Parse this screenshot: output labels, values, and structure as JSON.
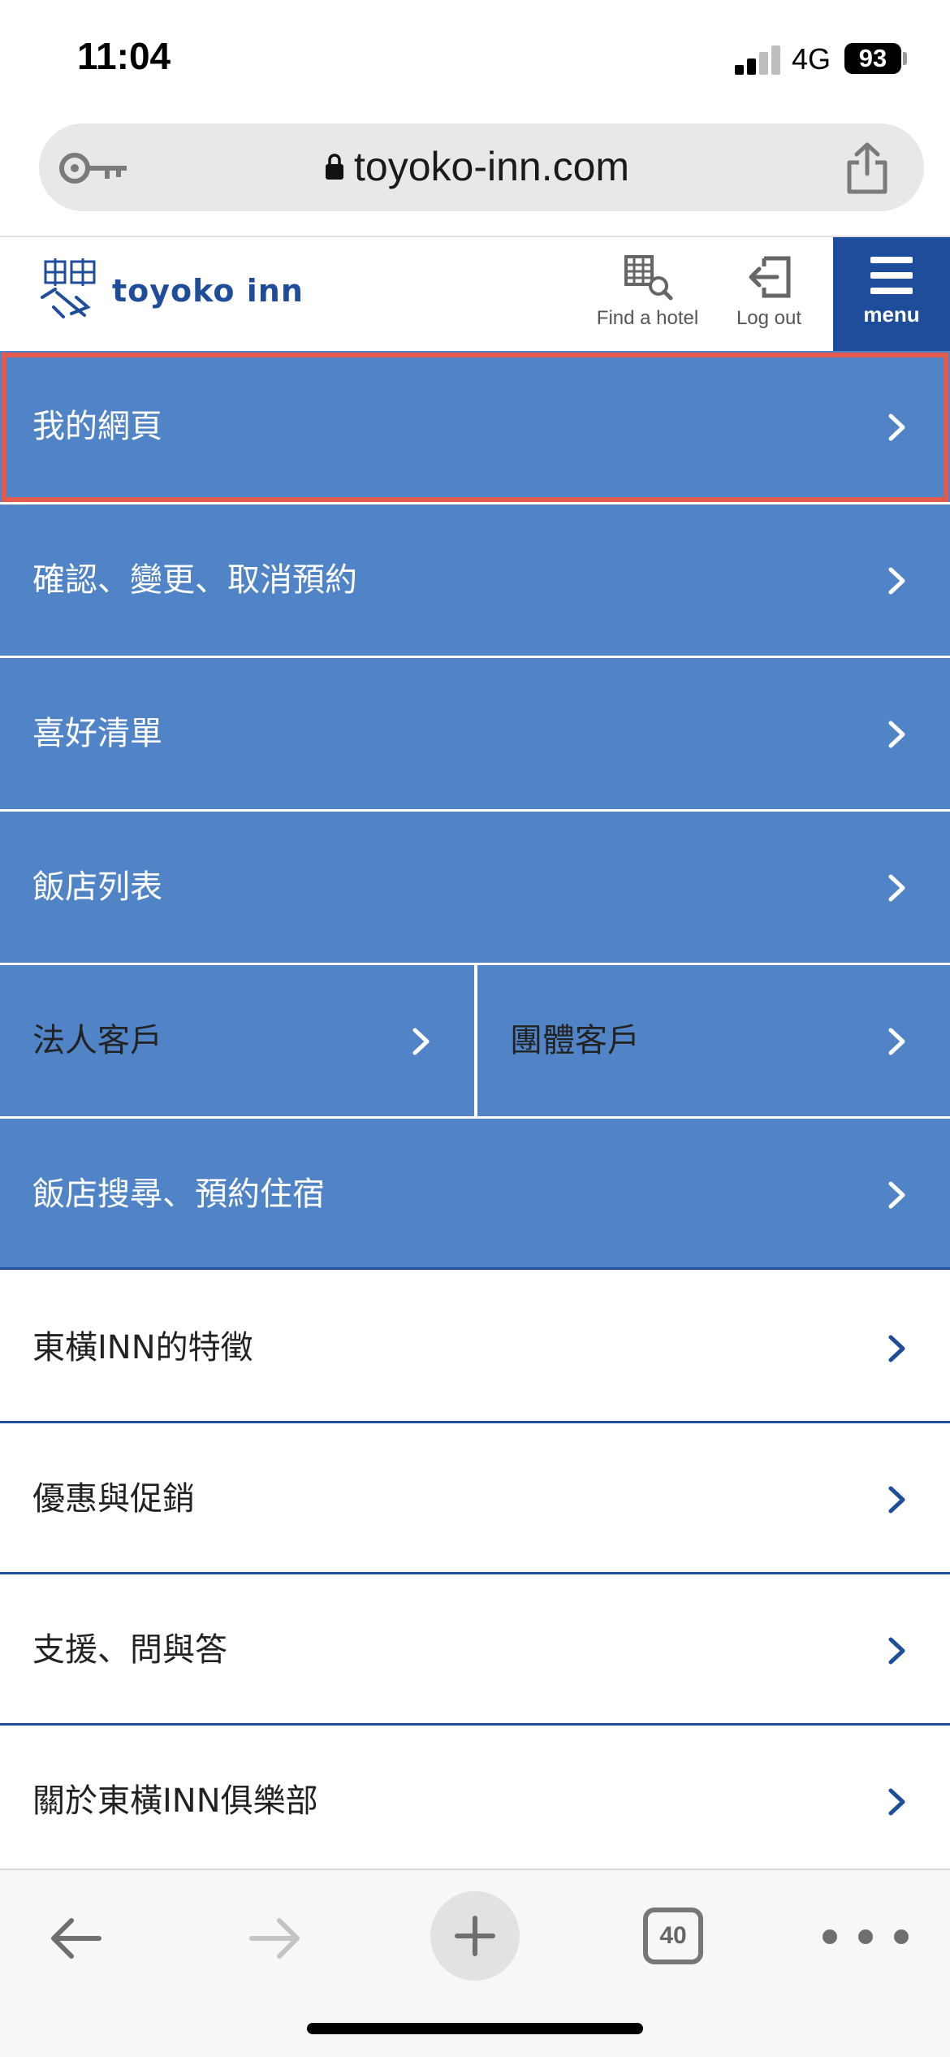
{
  "status_bar": {
    "time": "11:04",
    "network": "4G",
    "battery": "93"
  },
  "browser": {
    "url": "toyoko-inn.com",
    "tab_count": "40"
  },
  "header": {
    "logo_text": "toyoko inn",
    "find_hotel_label": "Find a hotel",
    "logout_label": "Log out",
    "menu_label": "menu",
    "brand_color": "#1e4d9c"
  },
  "menu": {
    "highlight_color": "#e25b4c",
    "blue_bg": "#5084c6",
    "items": [
      {
        "label": "我的網頁"
      },
      {
        "label": "確認、變更、取消預約"
      },
      {
        "label": "喜好清單"
      },
      {
        "label": "飯店列表"
      },
      {
        "label": "法人客戶"
      },
      {
        "label": "團體客戶"
      },
      {
        "label": "飯店搜尋、預約住宿"
      },
      {
        "label": "東橫INN的特徵"
      },
      {
        "label": "優惠與促銷"
      },
      {
        "label": "支援、問與答"
      },
      {
        "label": "關於東橫INN俱樂部"
      }
    ]
  }
}
